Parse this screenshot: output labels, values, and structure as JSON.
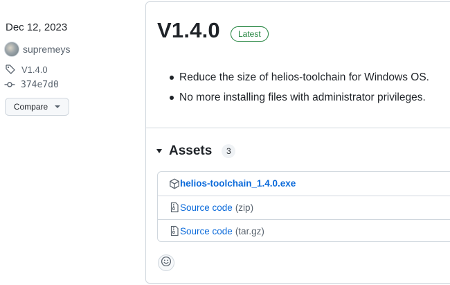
{
  "release": {
    "date": "Dec 12, 2023",
    "author": "supremeys",
    "tag": "V1.4.0",
    "commit": "374e7d0",
    "compare_label": "Compare",
    "title": "V1.4.0",
    "badge": "Latest",
    "notes": [
      "Reduce the size of helios-toolchain for Windows OS.",
      "No more installing files with administrator privileges."
    ]
  },
  "assets": {
    "title": "Assets",
    "count": "3",
    "items": [
      {
        "name": "helios-toolchain_1.4.0.exe",
        "ext": "",
        "icon": "package-icon"
      },
      {
        "name": "Source code",
        "ext": "(zip)",
        "icon": "file-zip-icon"
      },
      {
        "name": "Source code",
        "ext": "(tar.gz)",
        "icon": "file-zip-icon"
      }
    ]
  },
  "colors": {
    "link": "#0969da",
    "latest": "#1a7f37",
    "muted": "#59636e",
    "border": "#d0d7de"
  }
}
